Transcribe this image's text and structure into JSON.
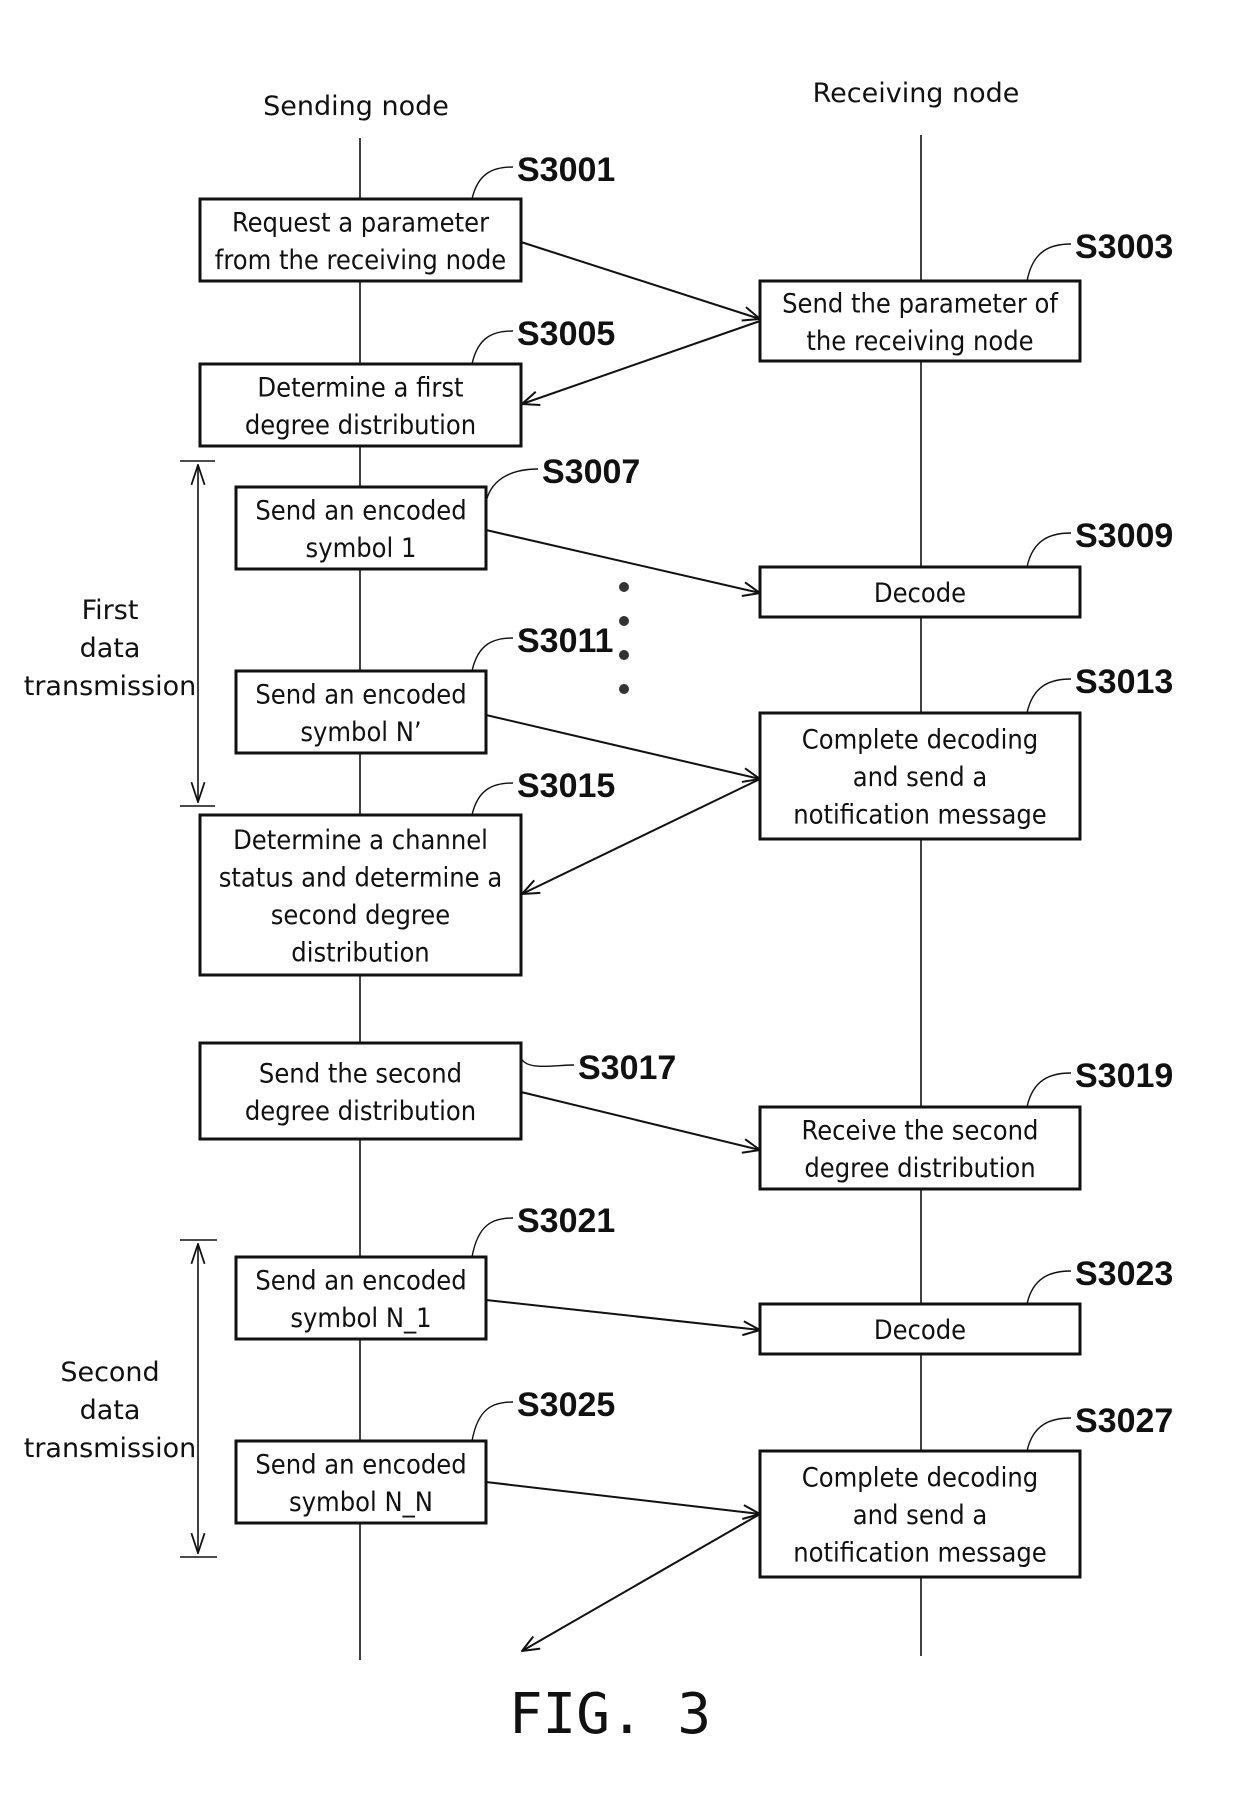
{
  "figure_label": "FIG. 3",
  "lanes": {
    "sending": "Sending node",
    "receiving": "Receiving node"
  },
  "steps": [
    {
      "id": "S3001",
      "lane": "sending",
      "lines": [
        "Request a parameter",
        "from the receiving node"
      ]
    },
    {
      "id": "S3003",
      "lane": "receiving",
      "lines": [
        "Send the parameter of",
        "the receiving node"
      ]
    },
    {
      "id": "S3005",
      "lane": "sending",
      "lines": [
        "Determine a first",
        "degree distribution"
      ]
    },
    {
      "id": "S3007",
      "lane": "sending",
      "lines": [
        "Send an encoded",
        "symbol 1"
      ]
    },
    {
      "id": "S3009",
      "lane": "receiving",
      "lines": [
        "Decode"
      ]
    },
    {
      "id": "S3011",
      "lane": "sending",
      "lines": [
        "Send an encoded",
        "symbol N’"
      ]
    },
    {
      "id": "S3013",
      "lane": "receiving",
      "lines": [
        "Complete decoding",
        "and send a",
        "notification message"
      ]
    },
    {
      "id": "S3015",
      "lane": "sending",
      "lines": [
        "Determine a channel",
        "status and determine a",
        "second degree",
        "distribution"
      ]
    },
    {
      "id": "S3017",
      "lane": "sending",
      "lines": [
        "Send the second",
        "degree distribution"
      ]
    },
    {
      "id": "S3019",
      "lane": "receiving",
      "lines": [
        "Receive the second",
        "degree distribution"
      ]
    },
    {
      "id": "S3021",
      "lane": "sending",
      "lines": [
        "Send an encoded",
        "symbol N_1"
      ]
    },
    {
      "id": "S3023",
      "lane": "receiving",
      "lines": [
        "Decode"
      ]
    },
    {
      "id": "S3025",
      "lane": "sending",
      "lines": [
        "Send an encoded",
        "symbol N_N"
      ]
    },
    {
      "id": "S3027",
      "lane": "receiving",
      "lines": [
        "Complete decoding",
        "and send a",
        "notification message"
      ]
    }
  ],
  "phases": [
    {
      "name": "first",
      "lines": [
        "First",
        "data",
        "transmission"
      ]
    },
    {
      "name": "second",
      "lines": [
        "Second",
        "data",
        "transmission"
      ]
    }
  ],
  "messages": [
    {
      "from": "S3001",
      "to": "S3003"
    },
    {
      "from": "S3003",
      "to": "S3005"
    },
    {
      "from": "S3007",
      "to": "S3009"
    },
    {
      "from": "S3011",
      "to": "S3013"
    },
    {
      "from": "S3013",
      "to": "S3015"
    },
    {
      "from": "S3017",
      "to": "S3019"
    },
    {
      "from": "S3021",
      "to": "S3023"
    },
    {
      "from": "S3025",
      "to": "S3027"
    },
    {
      "from": "S3027",
      "to": "sending"
    }
  ]
}
